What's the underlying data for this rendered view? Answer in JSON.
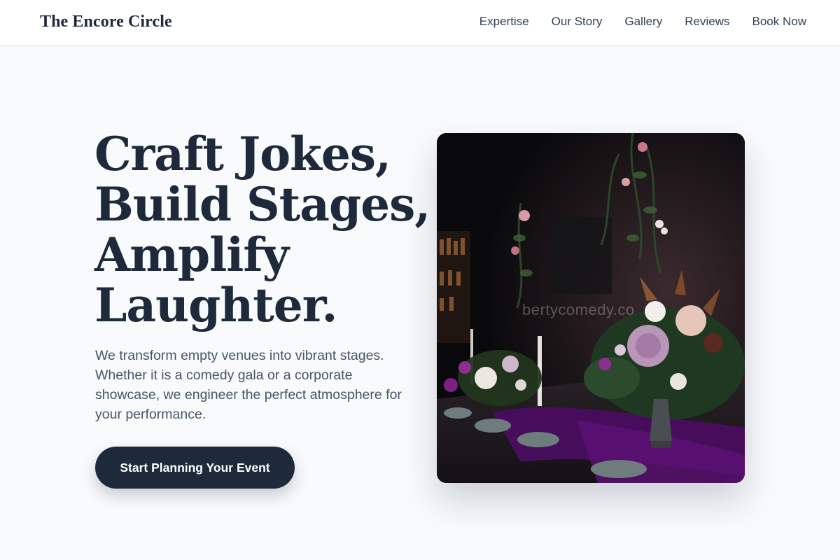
{
  "header": {
    "brand": "The Encore Circle",
    "nav": [
      {
        "label": "Expertise"
      },
      {
        "label": "Our Story"
      },
      {
        "label": "Gallery"
      },
      {
        "label": "Reviews"
      },
      {
        "label": "Book Now"
      }
    ]
  },
  "hero": {
    "title_lines": [
      "Craft Jokes,",
      "Build Stages,",
      "Amplify",
      "Laughter."
    ],
    "subtitle": "We transform empty venues into vibrant stages. Whether it is a comedy gala or a corporate showcase, we engineer the perfect atmosphere for your performance.",
    "cta_label": "Start Planning Your Event",
    "image": {
      "description": "dark venue table with floral centerpieces and candles",
      "watermark": "bertycomedy.co"
    }
  },
  "colors": {
    "background": "#f8fafc",
    "header_bg": "#ffffff",
    "text_dark": "#1e293b",
    "text_muted": "#475569",
    "cta_bg": "#1e293b",
    "cta_text": "#ffffff"
  }
}
